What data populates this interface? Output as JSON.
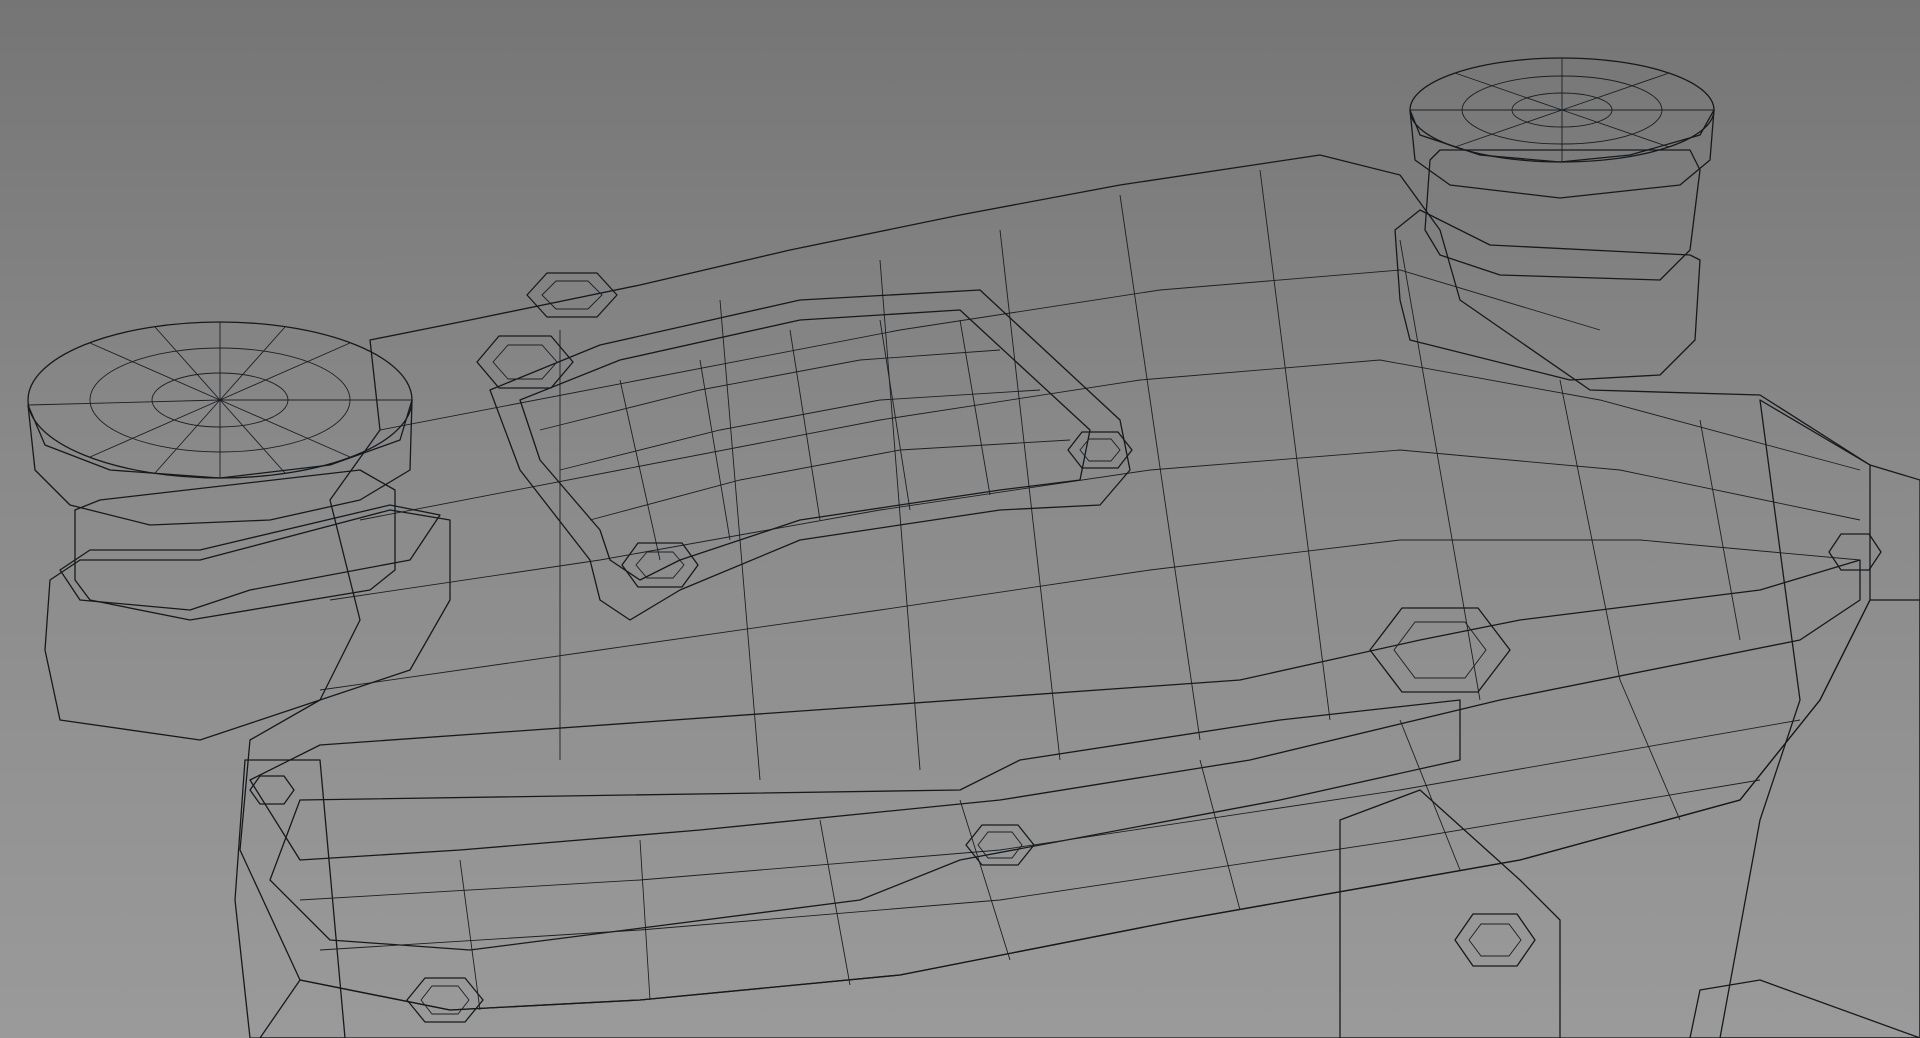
{
  "scene": {
    "background_color": "#8c8c8c",
    "mesh_color": "#3d4853",
    "wire_color": "#16191c",
    "shading": "wireframe-on-shaded"
  }
}
